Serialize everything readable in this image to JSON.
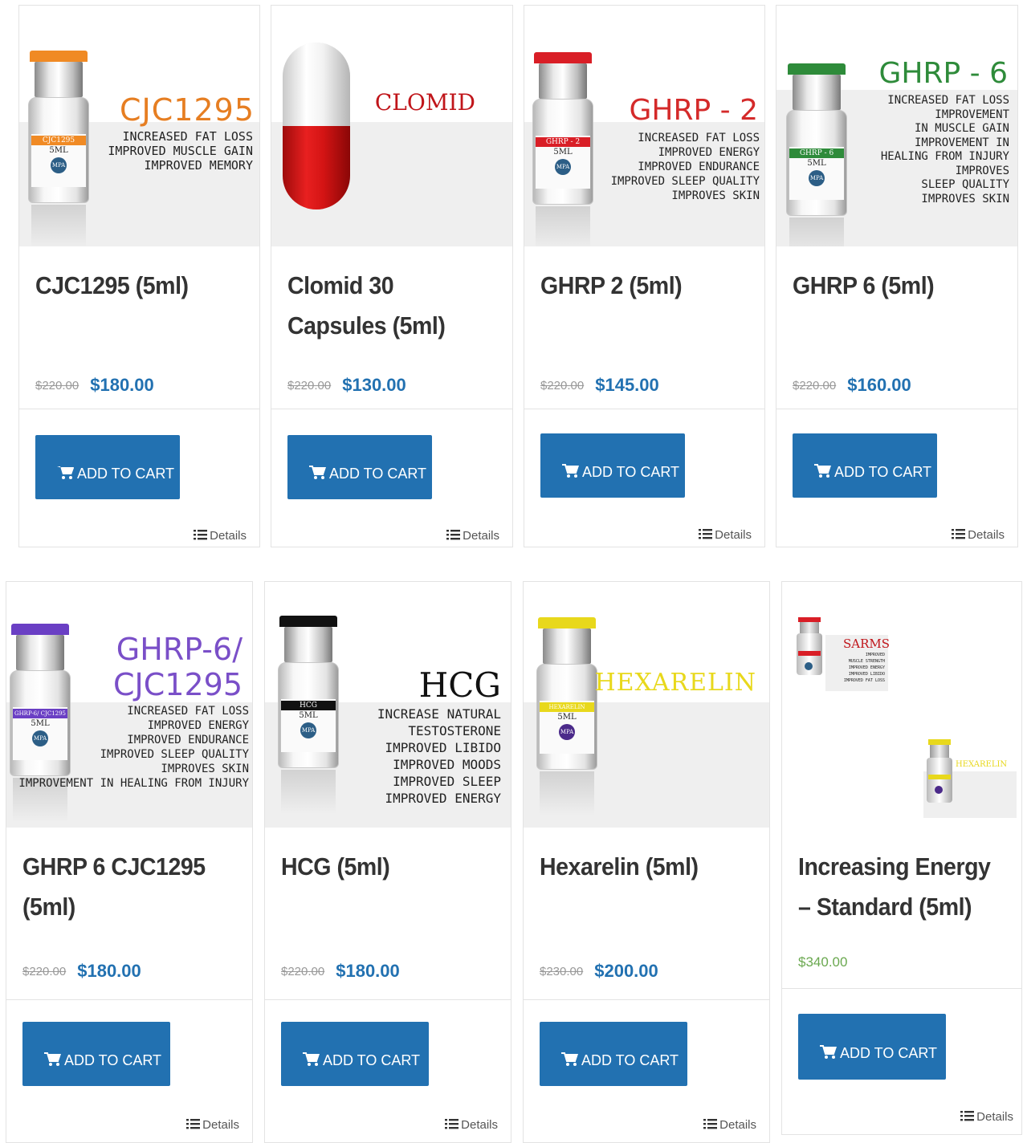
{
  "common": {
    "add_to_cart": "ADD TO CART",
    "details": "Details",
    "vial_volume": "5ML",
    "vial_brand": "MPA"
  },
  "products": [
    {
      "title": "CJC1295 (5ml)",
      "old_price": "$220.00",
      "price": "$180.00",
      "image": {
        "heading": "CJC1295",
        "lines": [
          "INCREASED FAT LOSS",
          "IMPROVED MUSCLE GAIN",
          "IMPROVED MEMORY"
        ],
        "label": "CJC1295"
      }
    },
    {
      "title": "Clomid 30 Capsules (5ml)",
      "old_price": "$220.00",
      "price": "$130.00",
      "image": {
        "heading": "CLOMID"
      }
    },
    {
      "title": "GHRP 2 (5ml)",
      "old_price": "$220.00",
      "price": "$145.00",
      "image": {
        "heading": "GHRP - 2",
        "lines": [
          "INCREASED FAT LOSS",
          "IMPROVED ENERGY",
          "IMPROVED ENDURANCE",
          "IMPROVED SLEEP QUALITY",
          "IMPROVES SKIN"
        ],
        "label": "GHRP - 2"
      }
    },
    {
      "title": "GHRP 6 (5ml)",
      "old_price": "$220.00",
      "price": "$160.00",
      "image": {
        "heading": "GHRP - 6",
        "lines": [
          "INCREASED FAT LOSS",
          "IMPROVEMENT",
          "IN MUSCLE GAIN",
          "IMPROVEMENT IN",
          "HEALING FROM INJURY",
          "IMPROVES",
          "SLEEP QUALITY",
          "IMPROVES SKIN"
        ],
        "label": "GHRP - 6"
      }
    },
    {
      "title": "GHRP 6 CJC1295 (5ml)",
      "old_price": "$220.00",
      "price": "$180.00",
      "image": {
        "heading1": "GHRP-6/",
        "heading2": "CJC1295",
        "lines": [
          "INCREASED FAT LOSS",
          "IMPROVED ENERGY",
          "IMPROVED ENDURANCE",
          "IMPROVED SLEEP QUALITY",
          "IMPROVES SKIN",
          "IMPROVEMENT IN HEALING FROM INJURY"
        ],
        "label": "GHRP-6/ CJC1295"
      }
    },
    {
      "title": "HCG (5ml)",
      "old_price": "$220.00",
      "price": "$180.00",
      "image": {
        "heading": "HCG",
        "lines": [
          "INCREASE NATURAL",
          "TESTOSTERONE",
          "IMPROVED LIBIDO",
          "IMPROVED MOODS",
          "IMPROVED SLEEP",
          "IMPROVED ENERGY"
        ],
        "label": "HCG"
      }
    },
    {
      "title": "Hexarelin (5ml)",
      "old_price": "$230.00",
      "price": "$200.00",
      "image": {
        "heading": "HEXARELIN",
        "label": "HEXARELIN"
      }
    },
    {
      "title": "Increasing Energy – Standard (5ml)",
      "price": "$340.00",
      "image": {
        "heading": "SARMS",
        "heading_b": "HEXARELIN",
        "lines": [
          "IMPROVED",
          "MUSCLE STRENGTH",
          "IMPROVED ENERGY",
          "IMPROVED LIBIDO",
          "IMPROVED FAT LOSS"
        ]
      }
    }
  ]
}
